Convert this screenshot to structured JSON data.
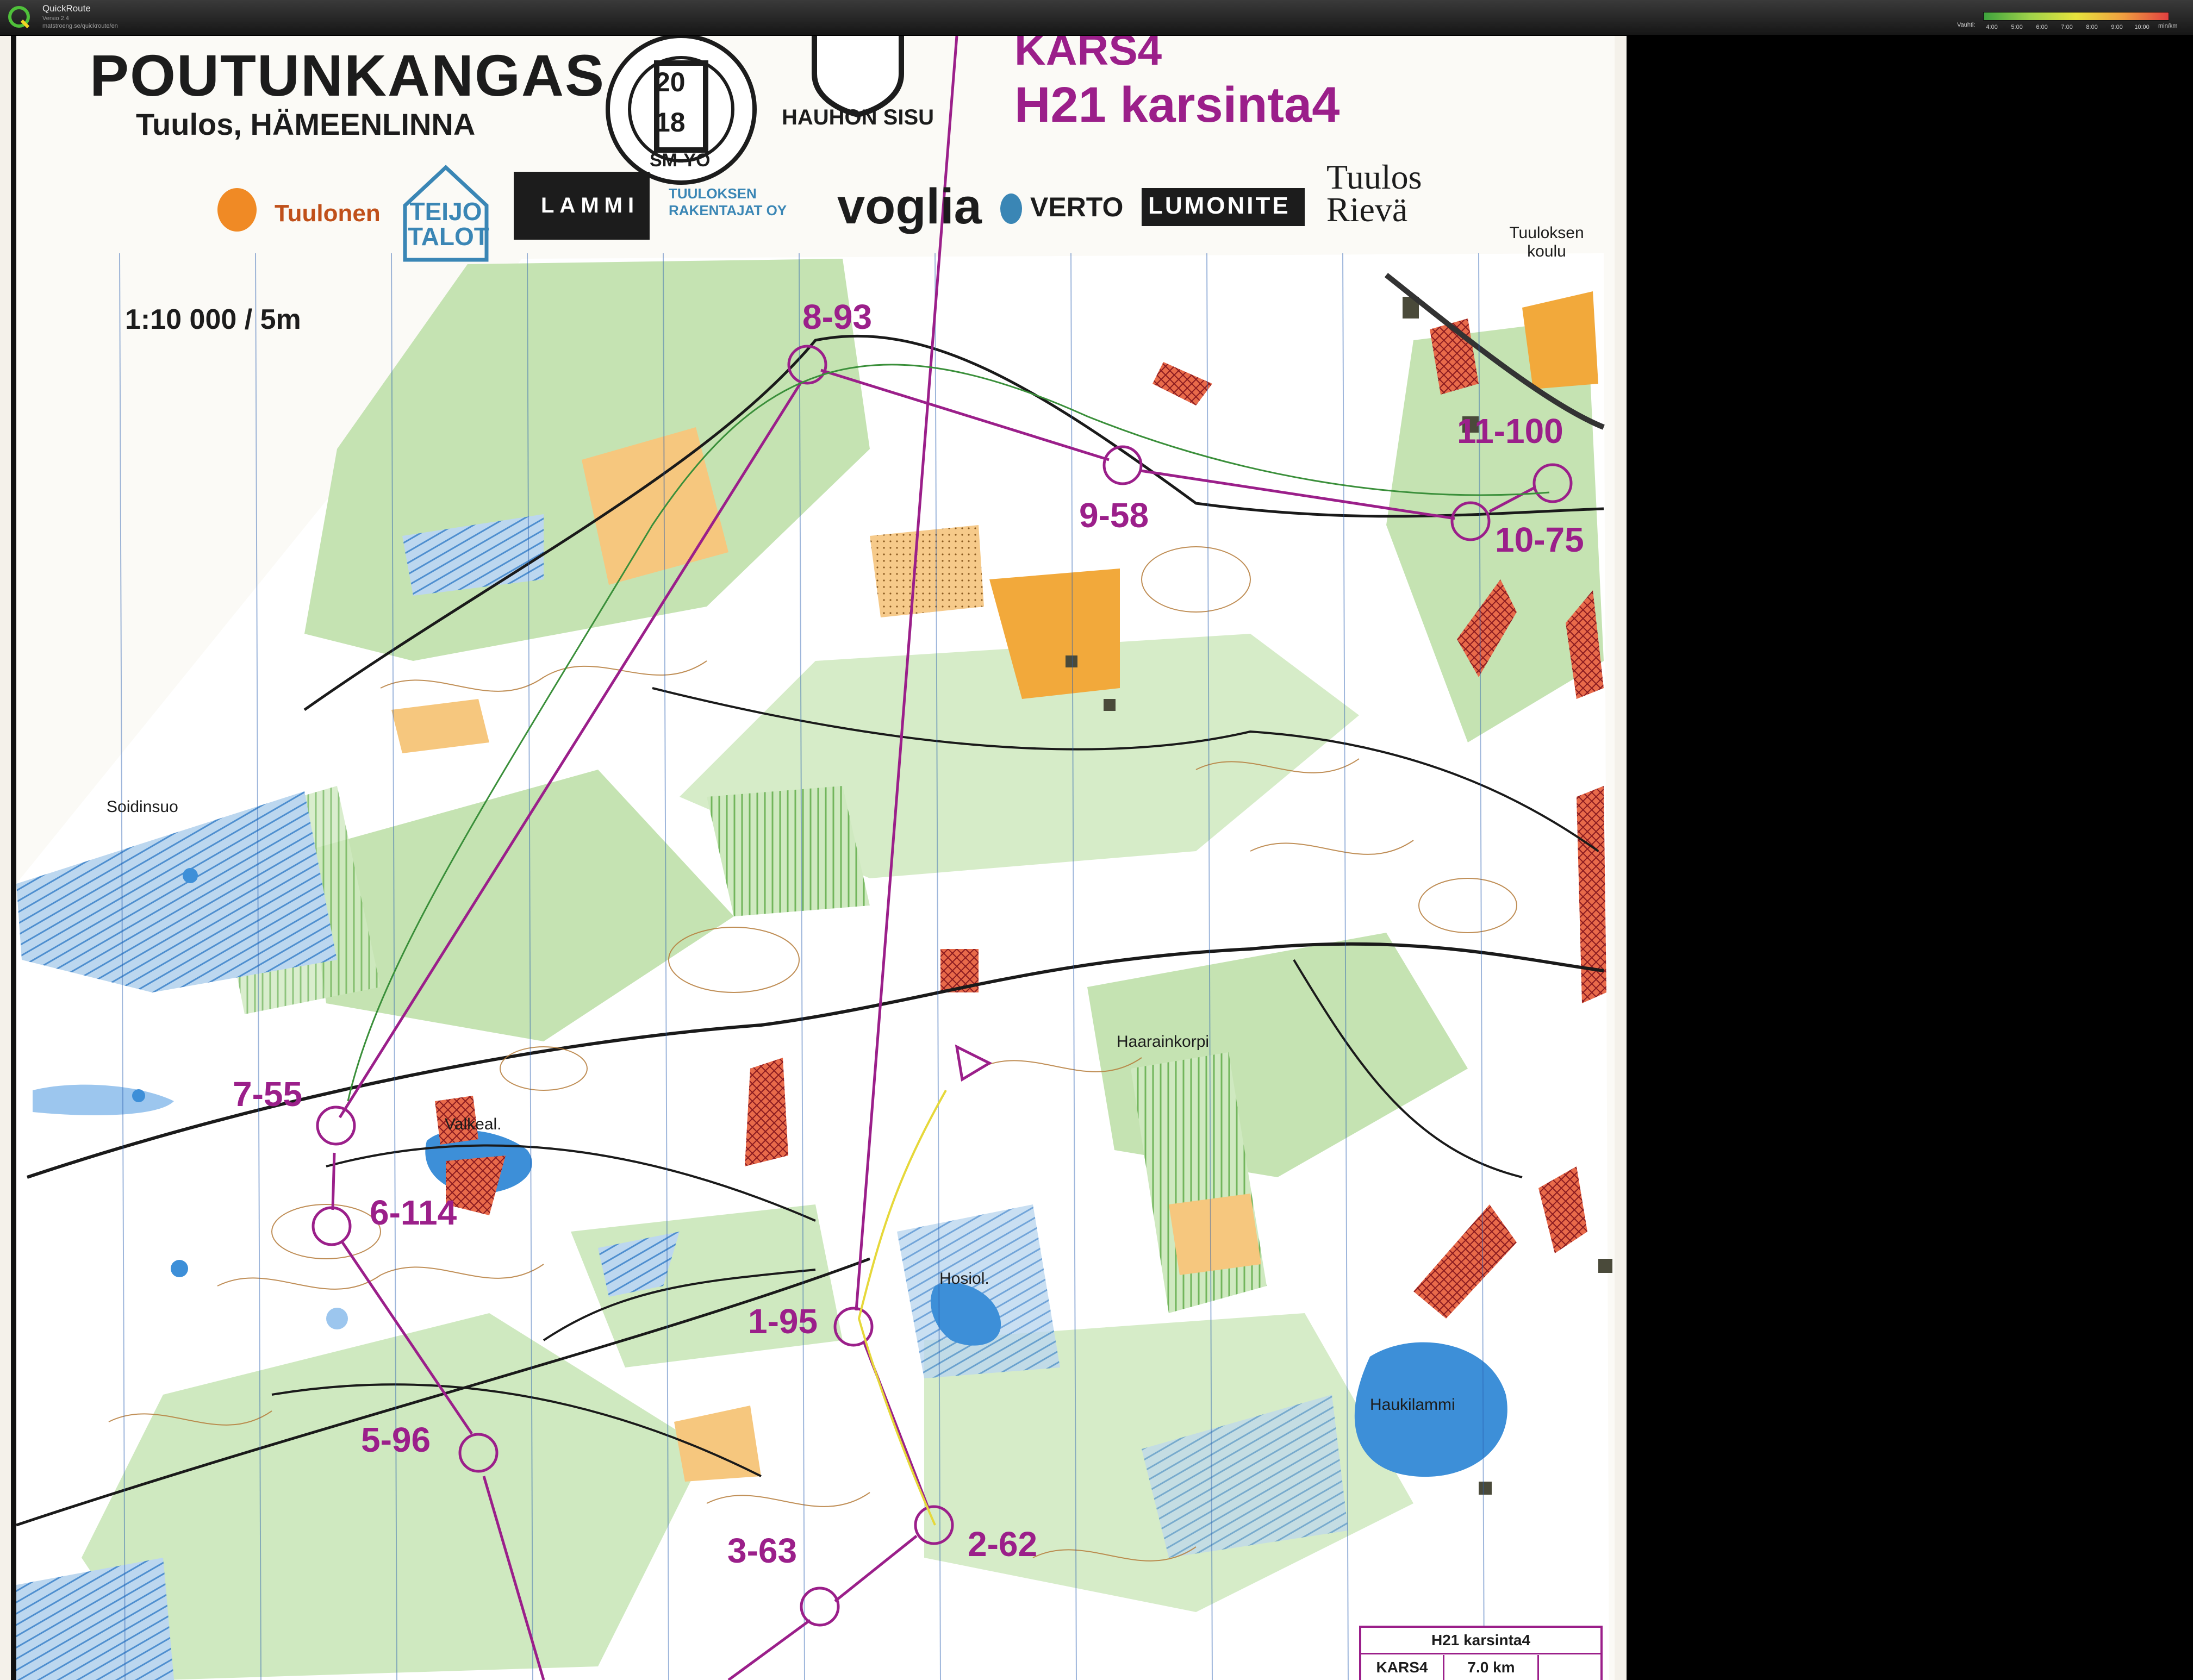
{
  "app": {
    "name": "QuickRoute",
    "version": "Versio 2.4",
    "url": "matstroeng.se/quickroute/en",
    "logo_icon": "quickroute-logo-icon"
  },
  "pace_legend": {
    "caption": "Vauhti:",
    "ticks": [
      "4:00",
      "5:00",
      "6:00",
      "7:00",
      "8:00",
      "9:00",
      "10:00"
    ],
    "unit": "min/km"
  },
  "map": {
    "title": "POUTUNKANGAS",
    "subtitle": "Tuulos, HÄMEENLINNA",
    "scale": "1:10 000 / 5m",
    "course_code": "KARS4",
    "course_name": "H21 karsinta4",
    "event_badge": {
      "year_top": "20",
      "year_bottom": "18",
      "caption": "SM-YÖ"
    },
    "club_badge": {
      "caption": "HAUHON SISU"
    },
    "sponsors": [
      "Tuulonen",
      "TEIJO TALOT",
      "LAMMI",
      "TUULOKSEN RAKENTAJAT OY",
      "voglia",
      "VERTO",
      "LUMONITE",
      "Tuulos Rievä"
    ],
    "places": [
      "Tuuloksen koulu",
      "Soidinsuo",
      "Valkeal.",
      "Haarainkorpi",
      "Hosiol.",
      "Haukilammi"
    ],
    "controls": [
      "8-93",
      "9-58",
      "11-100",
      "10-75",
      "7-55",
      "6-114",
      "1-95",
      "5-96",
      "2-62",
      "3-63"
    ],
    "legend_table": {
      "course": "H21 karsinta4",
      "code": "KARS4",
      "length": "7.0 km"
    },
    "colors": {
      "course": "#9b1f8a",
      "open": "#f2a93b",
      "forest": "#8fcc7a",
      "water": "#3d8fd8",
      "marsh": "#6aa5dd",
      "road": "#1a1a1a",
      "paper": "#f4f1ea"
    }
  }
}
